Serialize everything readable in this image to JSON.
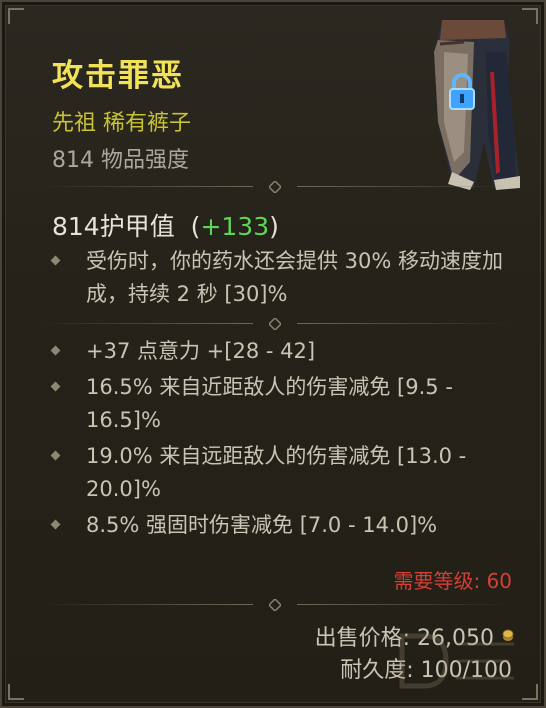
{
  "item": {
    "name": "攻击罪恶",
    "type": "先祖 稀有裤子",
    "item_power": "814 物品强度",
    "armor_label": "814护甲值",
    "armor_gain_open": "(",
    "armor_gain_value": "+133",
    "armor_gain_close": ")",
    "implicit": "受伤时，你的药水还会提供 30% 移动速度加成，持续 2 秒 [30]%",
    "affixes": [
      "+37 点意力 +[28 - 42]",
      "16.5% 来自近距敌人的伤害减免 [9.5 - 16.5]%",
      "19.0% 来自远距敌人的伤害减免 [13.0 - 20.0]%",
      "8.5% 强固时伤害减免 [7.0 - 14.0]%"
    ],
    "required_level": "需要等级: 60",
    "sell_price": "出售价格: 26,050",
    "durability": "耐久度: 100/100"
  },
  "icons": {
    "item": "pants-icon",
    "lock": "lock-icon",
    "gold": "gold-coin-icon"
  },
  "colors": {
    "title": "#f2e25a",
    "rarity": "#c8c235",
    "gain": "#5fd35a",
    "requirement": "#d43f36"
  }
}
